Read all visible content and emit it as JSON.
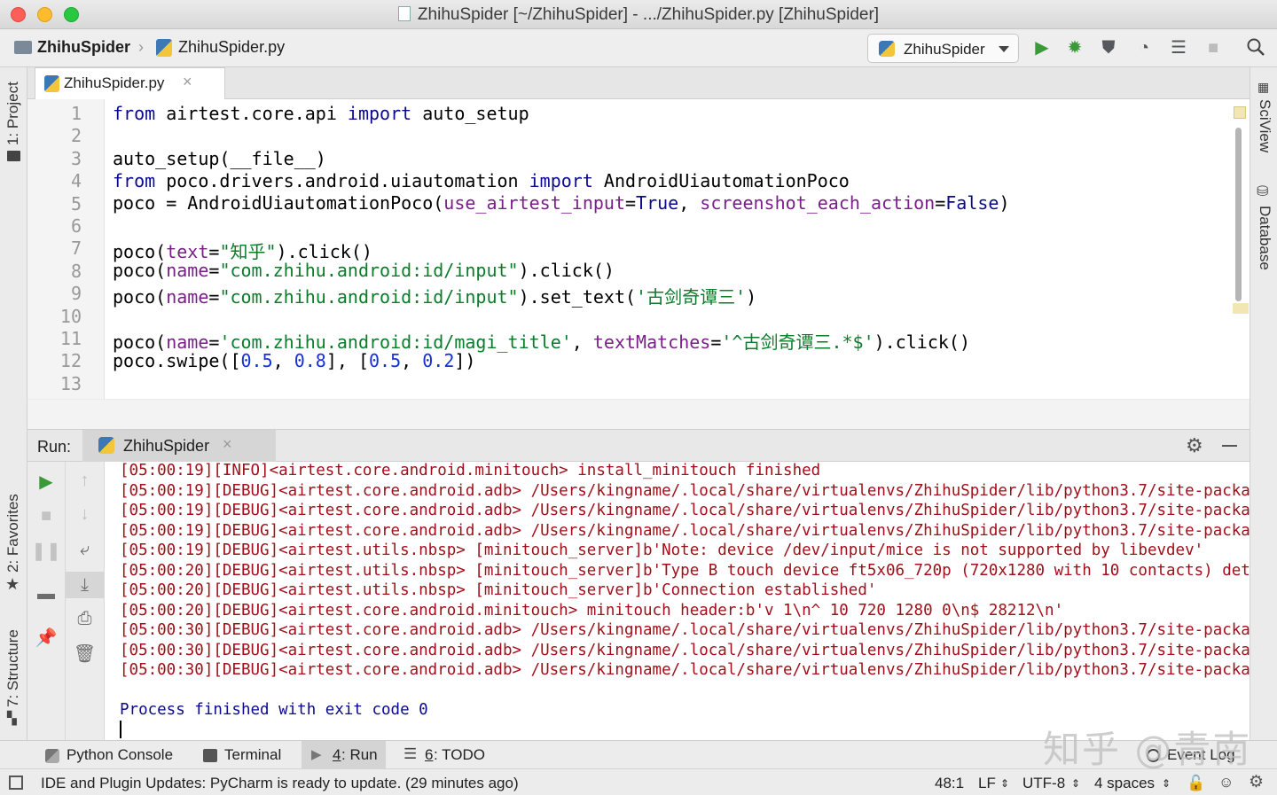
{
  "window": {
    "title": "ZhihuSpider [~/ZhihuSpider] - .../ZhihuSpider.py [ZhihuSpider]",
    "traffic_lights": {
      "close": "#fc5f57",
      "minimize": "#fdbc2e",
      "zoom": "#28c840"
    }
  },
  "navbar": {
    "project": "ZhihuSpider",
    "file": "ZhihuSpider.py",
    "run_config": "ZhihuSpider",
    "icons": [
      "run-icon",
      "debug-icon",
      "coverage-icon",
      "profile-icon",
      "concurrency-icon",
      "stop-icon",
      "search-icon"
    ]
  },
  "left_stripe": {
    "project": "1: Project",
    "favorites": "2: Favorites",
    "structure": "7: Structure"
  },
  "right_stripe": {
    "sciview": "SciView",
    "database": "Database"
  },
  "editor": {
    "tab": "ZhihuSpider.py",
    "line_numbers": [
      "1",
      "2",
      "3",
      "4",
      "5",
      "6",
      "7",
      "8",
      "9",
      "10",
      "11",
      "12",
      "13"
    ]
  },
  "run": {
    "label": "Run:",
    "tab": "ZhihuSpider",
    "log_lines": [
      "[05:00:19][INFO]<airtest.core.android.minitouch> install_minitouch finished",
      "[05:00:19][DEBUG]<airtest.core.android.adb> /Users/kingname/.local/share/virtualenvs/ZhihuSpider/lib/python3.7/site-packag",
      "[05:00:19][DEBUG]<airtest.core.android.adb> /Users/kingname/.local/share/virtualenvs/ZhihuSpider/lib/python3.7/site-packag",
      "[05:00:19][DEBUG]<airtest.core.android.adb> /Users/kingname/.local/share/virtualenvs/ZhihuSpider/lib/python3.7/site-packag",
      "[05:00:19][DEBUG]<airtest.utils.nbsp> [minitouch_server]b'Note: device /dev/input/mice is not supported by libevdev'",
      "[05:00:20][DEBUG]<airtest.utils.nbsp> [minitouch_server]b'Type B touch device ft5x06_720p (720x1280 with 10 contacts) dete",
      "[05:00:20][DEBUG]<airtest.utils.nbsp> [minitouch_server]b'Connection established'",
      "[05:00:20][DEBUG]<airtest.core.android.minitouch> minitouch header:b'v 1\\n^ 10 720 1280 0\\n$ 28212\\n'",
      "[05:00:30][DEBUG]<airtest.core.android.adb> /Users/kingname/.local/share/virtualenvs/ZhihuSpider/lib/python3.7/site-packag",
      "[05:00:30][DEBUG]<airtest.core.android.adb> /Users/kingname/.local/share/virtualenvs/ZhihuSpider/lib/python3.7/site-packag",
      "[05:00:30][DEBUG]<airtest.core.android.adb> /Users/kingname/.local/share/virtualenvs/ZhihuSpider/lib/python3.7/site-packag"
    ],
    "exit_message": "Process finished with exit code 0"
  },
  "tool_tabs": {
    "python_console": "Python Console",
    "terminal": "Terminal",
    "run_num": "4",
    "run": ": Run",
    "todo_num": "6",
    "todo": ": TODO",
    "event_log": "Event Log"
  },
  "status": {
    "message": "IDE and Plugin Updates: PyCharm is ready to update. (29 minutes ago)",
    "position": "48:1",
    "line_sep": "LF",
    "encoding": "UTF-8",
    "indent": "4 spaces"
  },
  "watermark": "知乎 @青南"
}
